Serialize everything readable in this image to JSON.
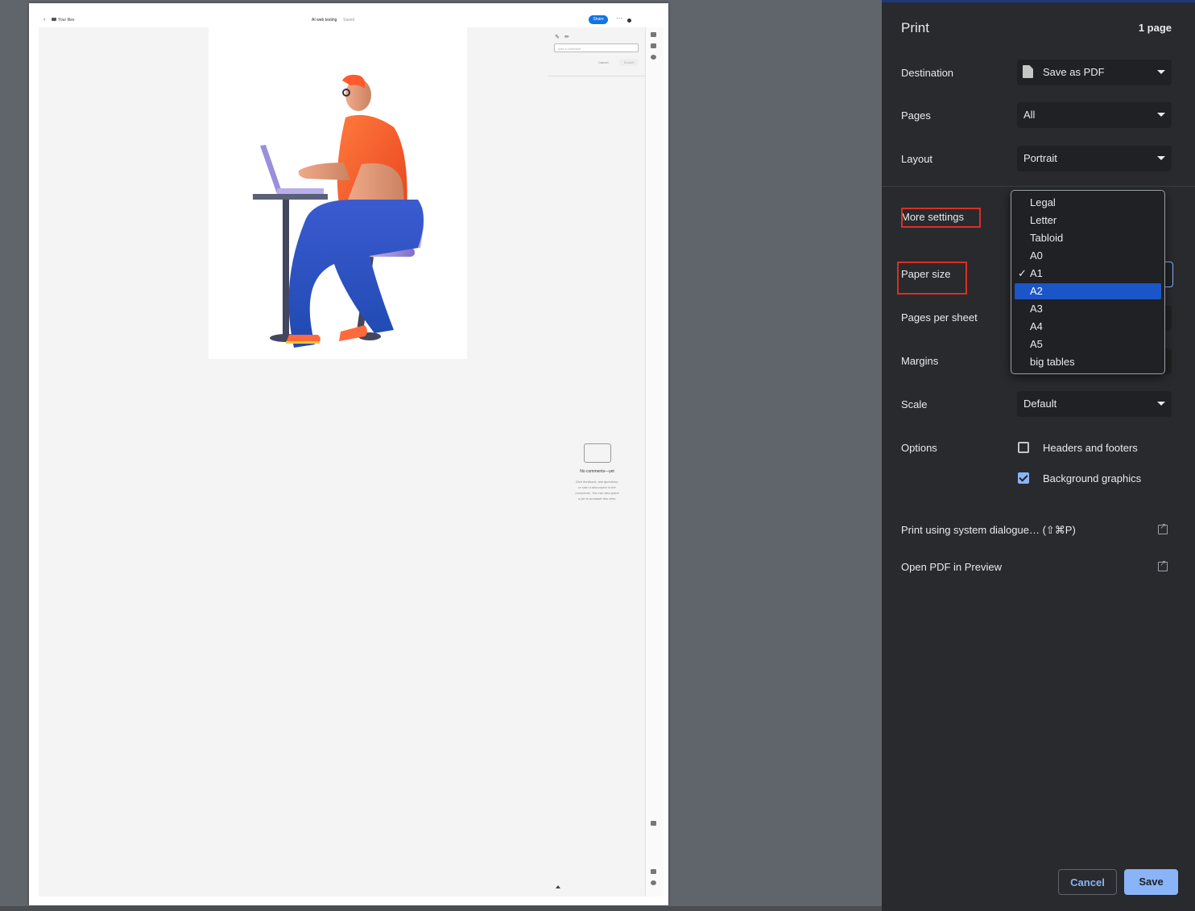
{
  "preview": {
    "files_label": "Your files",
    "doc_title": "AI web testing",
    "autosave": "Saved",
    "share_label": "Share",
    "more_label": "···",
    "comment_placeholder": "Add a comment",
    "cancel_label": "Cancel",
    "submit_label": "Submit",
    "no_comments_title": "No comments—yet",
    "no_comments_desc": "Give feedback, ask questions, or start a discussion in the comments. You can also place a pin to annotate this view."
  },
  "print": {
    "title": "Print",
    "page_count": "1 page",
    "destination_label": "Destination",
    "destination_value": "Save as PDF",
    "pages_label": "Pages",
    "pages_value": "All",
    "layout_label": "Layout",
    "layout_value": "Portrait",
    "more_settings_label": "More settings",
    "paper_size_label": "Paper size",
    "pages_per_sheet_label": "Pages per sheet",
    "margins_label": "Margins",
    "scale_label": "Scale",
    "scale_value": "Default",
    "options_label": "Options",
    "headers_footers_label": "Headers and footers",
    "headers_footers_checked": false,
    "background_graphics_label": "Background graphics",
    "background_graphics_checked": true,
    "system_dialogue_label": "Print using system dialogue… (⇧⌘P)",
    "open_pdf_label": "Open PDF in Preview",
    "cancel_label": "Cancel",
    "save_label": "Save"
  },
  "paper_dropdown": {
    "items": [
      "Legal",
      "Letter",
      "Tabloid",
      "A0",
      "A1",
      "A2",
      "A3",
      "A4",
      "A5",
      "big tables"
    ],
    "checked_item": "A1",
    "highlighted_item": "A2",
    "check_mark": "✓"
  },
  "colors": {
    "panel_bg": "#292a2d",
    "accent": "#8ab4f8",
    "highlight": "#1a56c8",
    "annotation_red": "#d93025",
    "backdrop": "#60646b"
  }
}
